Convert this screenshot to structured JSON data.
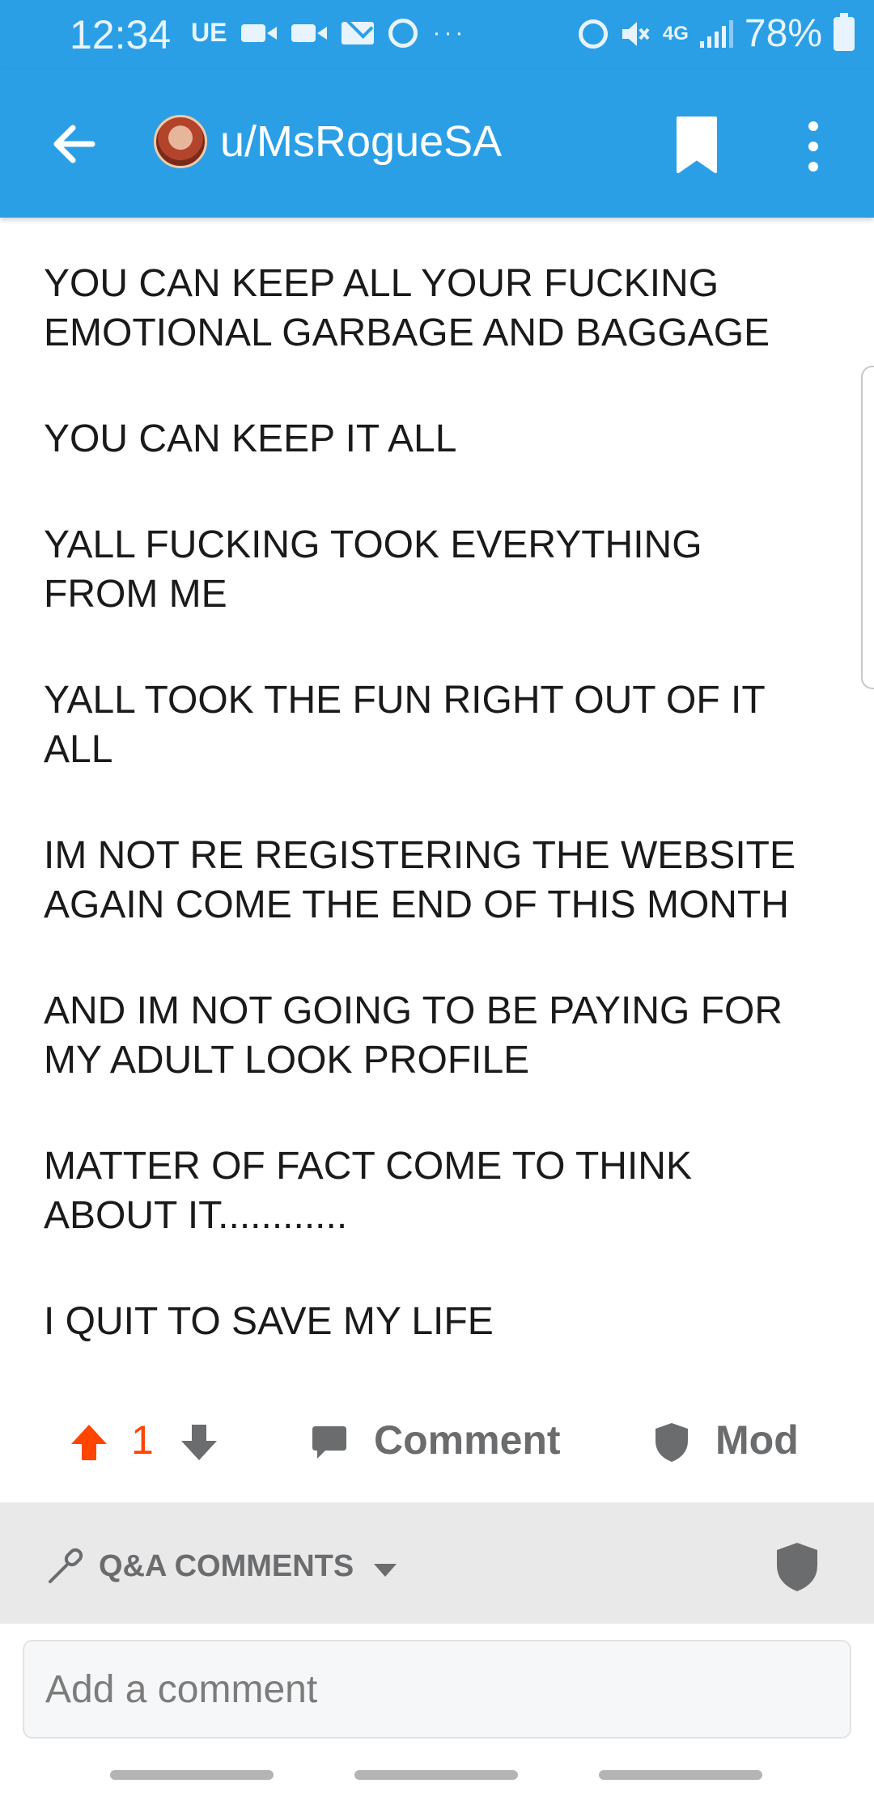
{
  "status_bar": {
    "time": "12:34",
    "carrier": "UE",
    "network": "4G",
    "battery": "78%",
    "icons": [
      "video-icon",
      "video-icon",
      "mail-icon",
      "alarm-icon",
      "more-dots-icon",
      "alarm-icon",
      "mute-icon",
      "signal-icon",
      "battery-icon"
    ]
  },
  "header": {
    "username": "u/MsRogueSA",
    "back_icon": "back-arrow-icon",
    "bookmark_icon": "bookmark-icon",
    "more_icon": "more-vertical-icon"
  },
  "post": {
    "paragraphs": [
      "YOU CAN KEEP ALL YOUR FUCKING\nEMOTIONAL GARBAGE AND BAGGAGE",
      "YOU CAN KEEP IT ALL",
      "YALL FUCKING TOOK EVERYTHING\nFROM ME",
      "YALL TOOK THE FUN RIGHT OUT OF IT\nALL",
      "IM NOT RE REGISTERING THE WEBSITE\nAGAIN COME THE END OF THIS MONTH",
      "AND IM NOT GOING TO BE PAYING FOR\nMY ADULT LOOK PROFILE",
      "MATTER OF FACT COME TO THINK\nABOUT IT............",
      "I QUIT TO SAVE MY LIFE"
    ]
  },
  "actions": {
    "score": "1",
    "comment_label": "Comment",
    "mod_label": "Mod",
    "upvote_color": "#ff4500"
  },
  "comments": {
    "sort_label": "Q&A COMMENTS",
    "input_placeholder": "Add a comment"
  },
  "colors": {
    "header_bg": "#2b9fe6",
    "upvote": "#ff4500",
    "muted": "#6a6c6e",
    "bar_bg": "#e9e9ea"
  }
}
